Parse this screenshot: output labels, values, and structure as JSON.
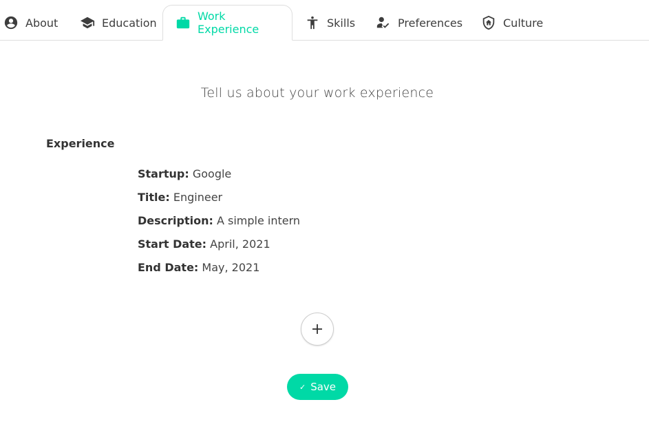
{
  "tabs": {
    "about": "About",
    "education": "Education",
    "work": "Work Experience",
    "skills": "Skills",
    "preferences": "Preferences",
    "culture": "Culture",
    "active_color": "#00d9a6"
  },
  "headline": "Tell us about your work experience",
  "experience": {
    "section_label": "Experience",
    "entries": [
      {
        "startup_label": "Startup:",
        "startup": "Google",
        "title_label": "Title:",
        "title": "Engineer",
        "description_label": "Description:",
        "description": "A simple intern",
        "start_label": "Start Date:",
        "start": "April, 2021",
        "end_label": "End Date:",
        "end": "May, 2021"
      }
    ]
  },
  "actions": {
    "add_icon": "plus-icon",
    "save_label": "Save",
    "save_icon": "check-icon",
    "save_color": "#00d9a6"
  }
}
